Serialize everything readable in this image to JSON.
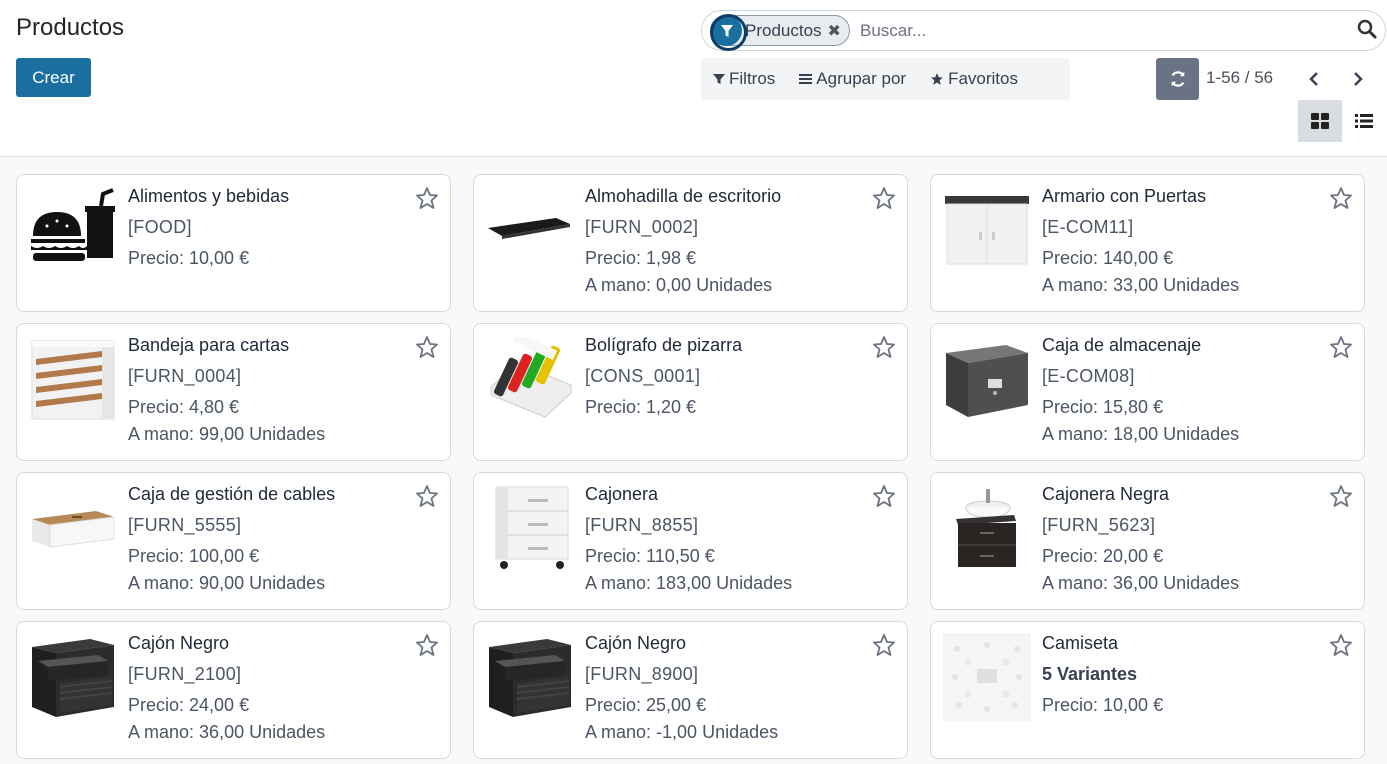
{
  "header": {
    "title": "Productos",
    "create_label": "Crear"
  },
  "search": {
    "facet_label": "Productos",
    "facet_remove": "✖",
    "placeholder": "Buscar..."
  },
  "filters": {
    "filters_label": "Filtros",
    "group_by_label": "Agrupar por",
    "favorites_label": "Favoritos"
  },
  "pager": {
    "value": "1-56 / 56"
  },
  "products": [
    {
      "name": "Alimentos y bebidas",
      "ref": "[FOOD]",
      "price": "Precio: 10,00 €",
      "stock": "",
      "image": "food-icon"
    },
    {
      "name": "Almohadilla de escritorio",
      "ref": "[FURN_0002]",
      "price": "Precio: 1,98 €",
      "stock": "A mano: 0,00 Unidades",
      "image": "desk-pad-image"
    },
    {
      "name": "Armario con Puertas",
      "ref": "[E-COM11]",
      "price": "Precio: 140,00 €",
      "stock": "A mano: 33,00 Unidades",
      "image": "cabinet-image"
    },
    {
      "name": "Bandeja para cartas",
      "ref": "[FURN_0004]",
      "price": "Precio: 4,80 €",
      "stock": "A mano: 99,00 Unidades",
      "image": "letter-tray-image"
    },
    {
      "name": "Bolígrafo de pizarra",
      "ref": "[CONS_0001]",
      "price": "Precio: 1,20 €",
      "stock": "",
      "image": "whiteboard-pens-image"
    },
    {
      "name": "Caja de almacenaje",
      "ref": "[E-COM08]",
      "price": "Precio: 15,80 €",
      "stock": "A mano: 18,00 Unidades",
      "image": "storage-box-image"
    },
    {
      "name": "Caja de gestión de cables",
      "ref": "[FURN_5555]",
      "price": "Precio: 100,00 €",
      "stock": "A mano: 90,00 Unidades",
      "image": "cable-box-image"
    },
    {
      "name": "Cajonera",
      "ref": "[FURN_8855]",
      "price": "Precio: 110,50 €",
      "stock": "A mano: 183,00 Unidades",
      "image": "drawer-unit-image"
    },
    {
      "name": "Cajonera Negra",
      "ref": "[FURN_5623]",
      "price": "Precio: 20,00 €",
      "stock": "A mano: 36,00 Unidades",
      "image": "black-drawer-unit-image"
    },
    {
      "name": "Cajón Negro",
      "ref": "[FURN_2100]",
      "price": "Precio: 24,00 €",
      "stock": "A mano: 36,00 Unidades",
      "image": "black-drawer-image"
    },
    {
      "name": "Cajón Negro",
      "ref": "[FURN_8900]",
      "price": "Precio: 25,00 €",
      "stock": "A mano: -1,00 Unidades",
      "image": "black-drawer-image"
    },
    {
      "name": "Camiseta",
      "ref": "5 Variantes",
      "price": "Precio: 10,00 €",
      "stock": "",
      "image": "tshirt-placeholder-image"
    }
  ]
}
